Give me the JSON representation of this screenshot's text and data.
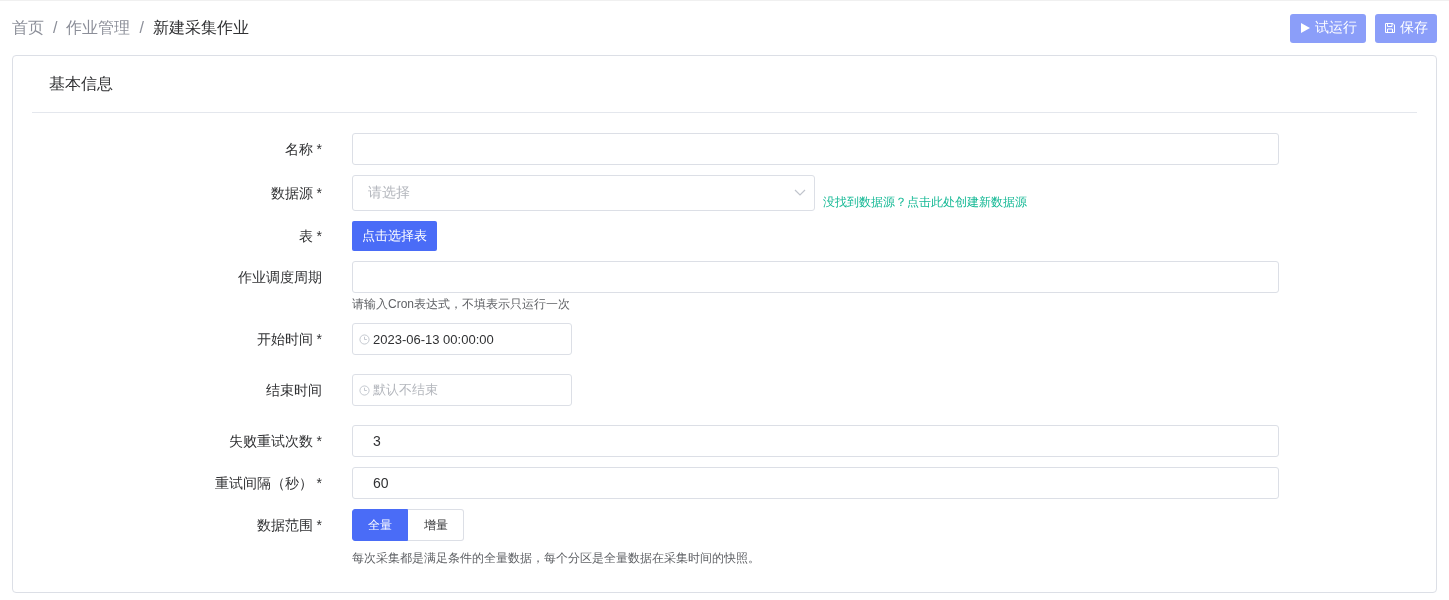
{
  "breadcrumb": [
    {
      "label": "首页",
      "current": false
    },
    {
      "label": "作业管理",
      "current": false
    },
    {
      "label": "新建采集作业",
      "current": true
    }
  ],
  "breadcrumb_separator": "/",
  "actions": [
    {
      "label": "试运行",
      "kind": "run",
      "disabled": true
    },
    {
      "label": "保存",
      "kind": "save",
      "disabled": true
    }
  ],
  "section": {
    "title": "基本信息"
  },
  "fields": [
    {
      "kind": "text",
      "label": "名称 *"
    },
    {
      "kind": "select",
      "label": "数据源 *",
      "placeholder": "请选择",
      "link": "没找到数据源？点击此处创建新数据源"
    },
    {
      "kind": "button",
      "label": "表 *",
      "button": "点击选择表"
    },
    {
      "kind": "text",
      "label": "作业调度周期",
      "hint": "请输入Cron表达式，不填表示只运行一次"
    },
    {
      "kind": "datetime",
      "label": "开始时间 *",
      "value": "2023-06-13 00:00:00"
    },
    {
      "kind": "datetime",
      "label": "结束时间",
      "placeholder": "默认不结束"
    },
    {
      "kind": "text",
      "label": "失败重试次数 *",
      "value": "3"
    },
    {
      "kind": "text",
      "label": "重试间隔（秒） *",
      "value": "60"
    },
    {
      "kind": "radio",
      "label": "数据范围 *",
      "options": [
        {
          "label": "全量",
          "selected": true
        },
        {
          "label": "增量",
          "selected": false
        }
      ],
      "hint": "每次采集都是满足条件的全量数据，每个分区是全量数据在采集时间的快照。"
    }
  ]
}
